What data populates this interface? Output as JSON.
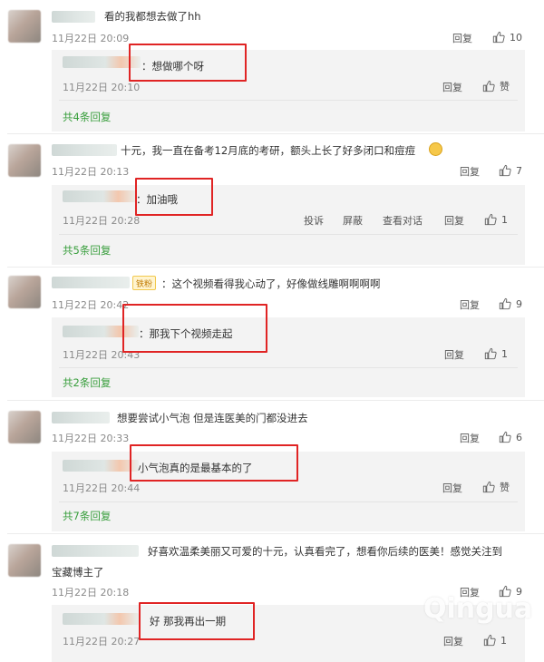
{
  "actions": {
    "reply": "回复",
    "like_text": "赞",
    "report": "投诉",
    "block": "屏蔽",
    "view_conversation": "查看对话"
  },
  "watermark": "Qingua",
  "comments": [
    {
      "text": "看的我都想去做了hh",
      "time": "11月22日 20:09",
      "likes": "10",
      "reply": {
        "text": "：想做哪个呀",
        "time": "11月22日 20:10",
        "likes": "赞"
      },
      "more": "共4条回复"
    },
    {
      "text": "十元，我一直在备考12月底的考研，额头上长了好多闭口和痘痘",
      "time": "11月22日 20:13",
      "likes": "7",
      "reply": {
        "text": "：加油哦",
        "time": "11月22日 20:28",
        "likes": "1"
      },
      "more": "共5条回复"
    },
    {
      "badge": "铁粉",
      "text": "：这个视频看得我心动了，好像做线雕啊啊啊啊",
      "time": "11月22日 20:42",
      "likes": "9",
      "reply": {
        "text": "：那我下个视频走起",
        "time": "11月22日 20:43",
        "likes": "1"
      },
      "more": "共2条回复"
    },
    {
      "text": "想要尝试小气泡 但是连医美的门都没进去",
      "time": "11月22日 20:33",
      "likes": "6",
      "reply": {
        "text": "小气泡真的是最基本的了",
        "time": "11月22日 20:44",
        "likes": "赞"
      },
      "more": "共7条回复"
    },
    {
      "text": "好喜欢温柔美丽又可爱的十元，认真看完了，想看你后续的医美！感觉关注到",
      "text2": "宝藏博主了",
      "time": "11月22日 20:18",
      "likes": "9",
      "reply": {
        "text": "好 那我再出一期",
        "time": "11月22日 20:27",
        "likes": "1"
      }
    }
  ]
}
